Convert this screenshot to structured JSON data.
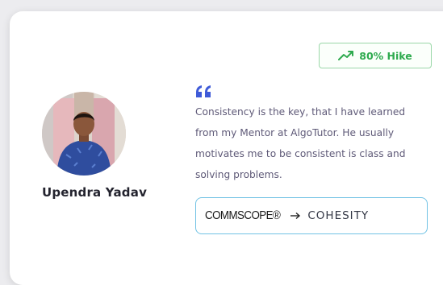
{
  "testimonial": {
    "hike_label": "80% Hike",
    "name": "Upendra Yadav",
    "quote": "Consistency is the key, that I have learned from my Mentor at AlgoTutor. He usually motivates me to be consistent is class and solving problems.",
    "from_company": "COMMSCOPE®",
    "to_company": "COHESITY"
  },
  "icons": {
    "hike": "trending-up-icon",
    "quote": "quote-icon",
    "arrow": "arrow-right-icon"
  },
  "colors": {
    "hike_green": "#2eaa4e",
    "quote_blue": "#3f5bd8",
    "company_border": "#71c2e4",
    "text_muted": "#5f5a78"
  }
}
